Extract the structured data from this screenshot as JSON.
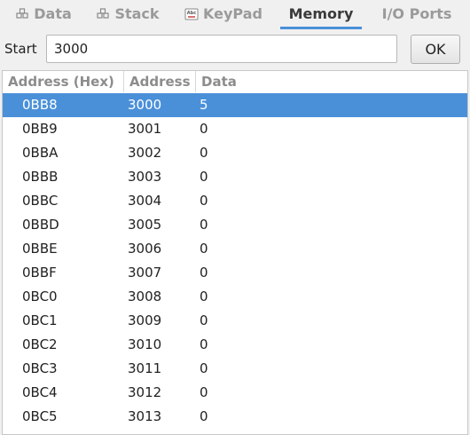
{
  "tabs": [
    {
      "label": "Data",
      "icon": "data-icon",
      "active": false
    },
    {
      "label": "Stack",
      "icon": "stack-icon",
      "active": false
    },
    {
      "label": "KeyPad",
      "icon": "keypad-icon",
      "active": false
    },
    {
      "label": "Memory",
      "icon": "",
      "active": true
    },
    {
      "label": "I/O Ports",
      "icon": "",
      "active": false
    }
  ],
  "start": {
    "label": "Start",
    "value": "3000",
    "ok_label": "OK"
  },
  "table": {
    "columns": [
      "Address (Hex)",
      "Address",
      "Data"
    ],
    "rows": [
      {
        "hex": "0BB8",
        "addr": "3000",
        "data": "5",
        "selected": true
      },
      {
        "hex": "0BB9",
        "addr": "3001",
        "data": "0"
      },
      {
        "hex": "0BBA",
        "addr": "3002",
        "data": "0"
      },
      {
        "hex": "0BBB",
        "addr": "3003",
        "data": "0"
      },
      {
        "hex": "0BBC",
        "addr": "3004",
        "data": "0"
      },
      {
        "hex": "0BBD",
        "addr": "3005",
        "data": "0"
      },
      {
        "hex": "0BBE",
        "addr": "3006",
        "data": "0"
      },
      {
        "hex": "0BBF",
        "addr": "3007",
        "data": "0"
      },
      {
        "hex": "0BC0",
        "addr": "3008",
        "data": "0"
      },
      {
        "hex": "0BC1",
        "addr": "3009",
        "data": "0"
      },
      {
        "hex": "0BC2",
        "addr": "3010",
        "data": "0"
      },
      {
        "hex": "0BC3",
        "addr": "3011",
        "data": "0"
      },
      {
        "hex": "0BC4",
        "addr": "3012",
        "data": "0"
      },
      {
        "hex": "0BC5",
        "addr": "3013",
        "data": "0"
      }
    ]
  },
  "colors": {
    "accent": "#4a90d9",
    "selected_row": "#4a90d9"
  }
}
